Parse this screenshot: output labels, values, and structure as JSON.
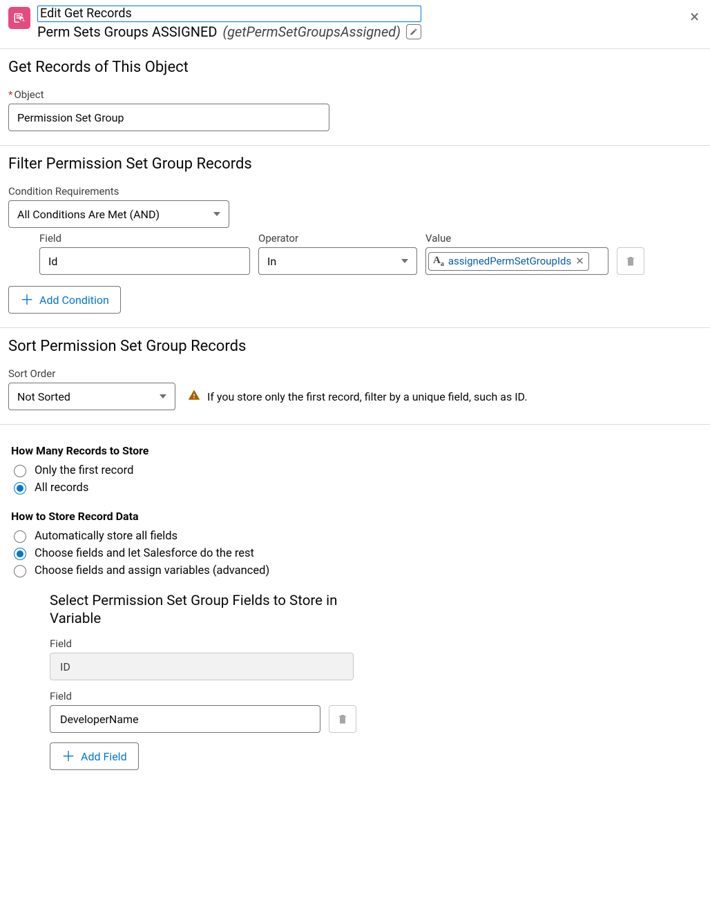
{
  "header": {
    "title": "Edit Get Records",
    "name": "Perm Sets Groups ASSIGNED",
    "api": "(getPermSetGroupsAssigned)"
  },
  "object_section": {
    "title": "Get Records of This Object",
    "label": "Object",
    "value": "Permission Set Group"
  },
  "filter_section": {
    "title": "Filter Permission Set Group Records",
    "cond_req_label": "Condition Requirements",
    "cond_req_value": "All Conditions Are Met (AND)",
    "cols": {
      "field": "Field",
      "operator": "Operator",
      "value": "Value"
    },
    "row": {
      "field": "Id",
      "operator": "In",
      "value_pill": "assignedPermSetGroupIds"
    },
    "add_condition": "Add Condition"
  },
  "sort_section": {
    "title": "Sort Permission Set Group Records",
    "label": "Sort Order",
    "value": "Not Sorted",
    "warning": "If you store only the first record, filter by a unique field, such as ID."
  },
  "store": {
    "how_many_title": "How Many Records to Store",
    "how_many_opts": [
      "Only the first record",
      "All records"
    ],
    "how_many_selected": 1,
    "how_store_title": "How to Store Record Data",
    "how_store_opts": [
      "Automatically store all fields",
      "Choose fields and let Salesforce do the rest",
      "Choose fields and assign variables (advanced)"
    ],
    "how_store_selected": 1,
    "select_fields_title": "Select Permission Set Group Fields to Store in Variable",
    "field_label": "Field",
    "fields": [
      "ID",
      "DeveloperName"
    ],
    "add_field": "Add Field"
  }
}
